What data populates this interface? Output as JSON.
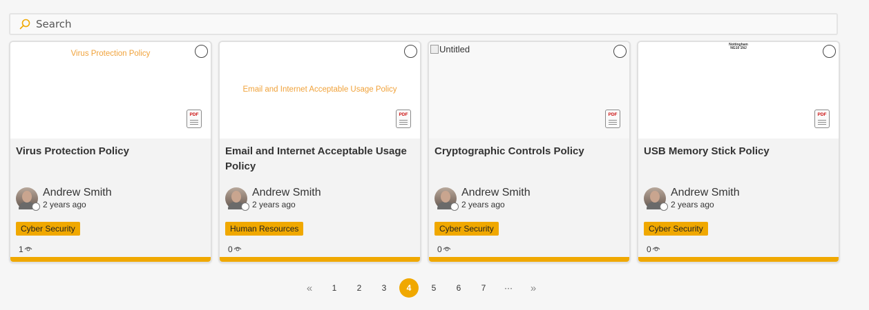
{
  "search": {
    "placeholder": "Search"
  },
  "colors": {
    "accent": "#f0a800",
    "thumb_text": "#f0a23a"
  },
  "cards": [
    {
      "thumb_text": "Virus Protection Policy",
      "title": "Virus Protection Policy",
      "author": "Andrew Smith",
      "time": "2 years ago",
      "tag": "Cyber Security",
      "views": "1",
      "file_type": "PDF"
    },
    {
      "thumb_text": "Email and Internet Acceptable Usage Policy",
      "title": "Email and Internet Acceptable Usage Policy",
      "author": "Andrew Smith",
      "time": "2 years ago",
      "tag": "Human Resources",
      "views": "0",
      "file_type": "PDF"
    },
    {
      "thumb_text": "Untitled",
      "title": "Cryptographic Controls Policy",
      "author": "Andrew Smith",
      "time": "2 years ago",
      "tag": "Cyber Security",
      "views": "0",
      "file_type": "PDF"
    },
    {
      "thumb_text_lines": [
        "Nottingham",
        "NG10 1NJ"
      ],
      "title": "USB Memory Stick Policy",
      "author": "Andrew Smith",
      "time": "2 years ago",
      "tag": "Cyber Security",
      "views": "0",
      "file_type": "PDF"
    }
  ],
  "pagination": {
    "first": "«",
    "pages": [
      "1",
      "2",
      "3",
      "4",
      "5",
      "6",
      "7"
    ],
    "current": "4",
    "ellipsis": "···",
    "last": "»"
  }
}
